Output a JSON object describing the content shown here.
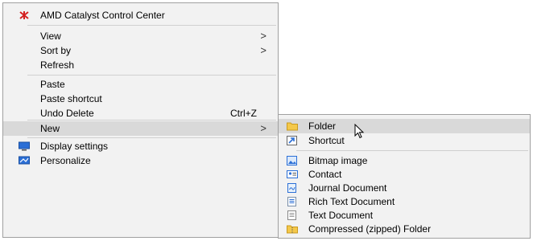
{
  "context_menu": {
    "amd_label": "AMD Catalyst Control Center",
    "view_label": "View",
    "view_arrow": ">",
    "sort_by_label": "Sort by",
    "sort_by_arrow": ">",
    "refresh_label": "Refresh",
    "paste_label": "Paste",
    "paste_shortcut_label": "Paste shortcut",
    "undo_delete_label": "Undo Delete",
    "undo_delete_shortcut": "Ctrl+Z",
    "new_label": "New",
    "new_arrow": ">",
    "display_settings_label": "Display settings",
    "personalize_label": "Personalize"
  },
  "new_submenu": {
    "folder_label": "Folder",
    "shortcut_label": "Shortcut",
    "bitmap_label": "Bitmap image",
    "contact_label": "Contact",
    "journal_label": "Journal Document",
    "rich_text_label": "Rich Text Document",
    "text_doc_label": "Text Document",
    "zip_folder_label": "Compressed (zipped) Folder"
  },
  "colors": {
    "menu_bg": "#f2f2f2",
    "highlight_bg": "#d9d9d9",
    "border": "#a0a0a0",
    "folder_yellow": "#f4c84a",
    "amd_red": "#d42020",
    "windows_blue": "#2b6fd6"
  },
  "icons": {
    "amd": "amd-logo-icon",
    "display": "display-monitor-icon",
    "personalize": "personalize-icon",
    "folder": "folder-icon",
    "shortcut": "shortcut-arrow-icon",
    "bitmap": "bitmap-image-icon",
    "contact": "contact-card-icon",
    "journal": "journal-document-icon",
    "rich_text": "rich-text-document-icon",
    "text_doc": "text-document-icon",
    "zip_folder": "zip-folder-icon",
    "cursor": "mouse-pointer-icon"
  }
}
